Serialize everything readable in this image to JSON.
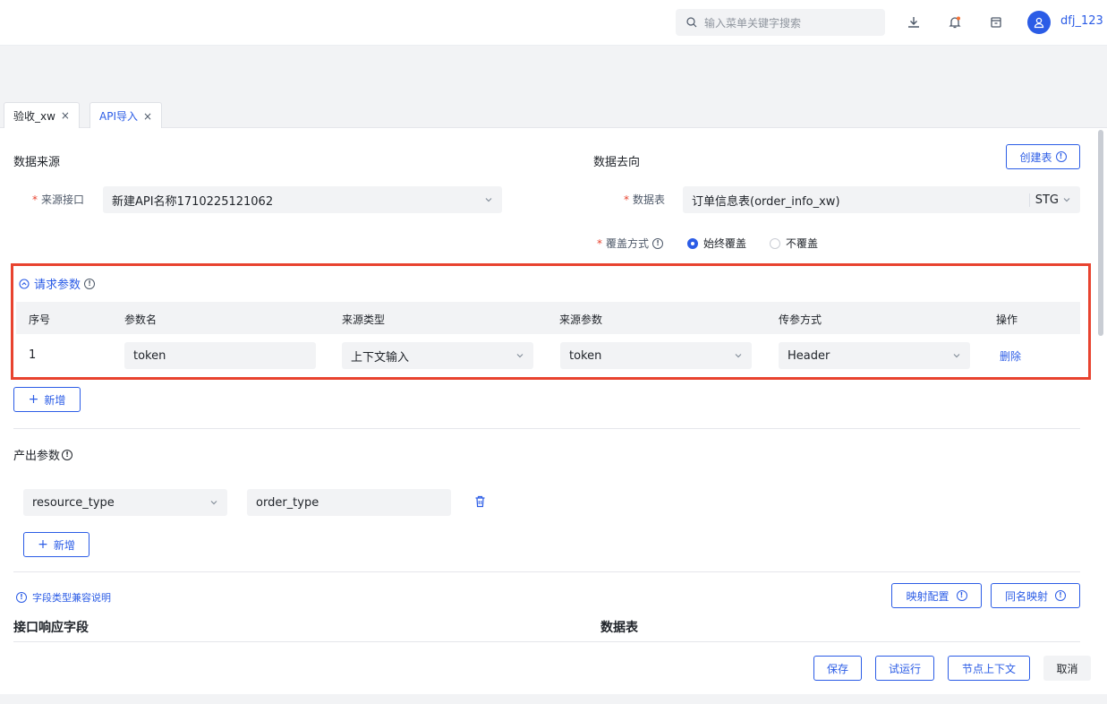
{
  "header": {
    "search_placeholder": "输入菜单关键字搜索",
    "username": "dfj_123"
  },
  "tabs": [
    {
      "label": "验收_xw",
      "close": "×"
    },
    {
      "label": "API导入",
      "close": "×"
    }
  ],
  "source": {
    "title": "数据来源",
    "interface_label": "来源接口",
    "interface_value": "新建API名称1710225121062"
  },
  "target": {
    "title": "数据去向",
    "create_table_btn": "创建表",
    "table_label": "数据表",
    "table_value": "订单信息表(order_info_xw)",
    "env_value": "STG",
    "cover_label": "覆盖方式",
    "cover_options": [
      "始终覆盖",
      "不覆盖"
    ]
  },
  "request_params": {
    "title": "请求参数",
    "columns": [
      "序号",
      "参数名",
      "来源类型",
      "来源参数",
      "传参方式",
      "操作"
    ],
    "rows": [
      {
        "index": "1",
        "name": "token",
        "source_type": "上下文输入",
        "source_param": "token",
        "pass_method": "Header",
        "action": "删除"
      }
    ],
    "add_btn": "新增"
  },
  "output_params": {
    "title": "产出参数",
    "rows": [
      {
        "field": "resource_type",
        "value": "order_type"
      }
    ],
    "add_btn": "新增"
  },
  "mapping": {
    "compat_link": "字段类型兼容说明",
    "mapping_config_btn": "映射配置",
    "same_name_btn": "同名映射",
    "left_title": "接口响应字段",
    "right_title": "数据表"
  },
  "footer": {
    "save": "保存",
    "trial_run": "试运行",
    "node_context": "节点上下文",
    "cancel": "取消"
  },
  "colors": {
    "primary": "#2b5ce6",
    "highlight_box": "#e8432f",
    "required": "#e8432f"
  }
}
